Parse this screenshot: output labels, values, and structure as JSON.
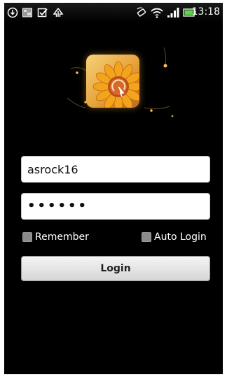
{
  "status_bar": {
    "time": "13:18",
    "icons": [
      "download-icon",
      "image-icon",
      "checkbox-icon",
      "upload-icon",
      "rotate-icon",
      "wifi-icon",
      "signal-icon",
      "battery-icon"
    ]
  },
  "login_form": {
    "username_value": "asrock16",
    "password_value": "••••••",
    "remember_label": "Remember",
    "auto_login_label": "Auto Login",
    "login_button_label": "Login"
  },
  "colors": {
    "screen_background": "#000000",
    "checkbox_fill": "#8a8a8a",
    "logo_orange": "#e6a23a"
  }
}
